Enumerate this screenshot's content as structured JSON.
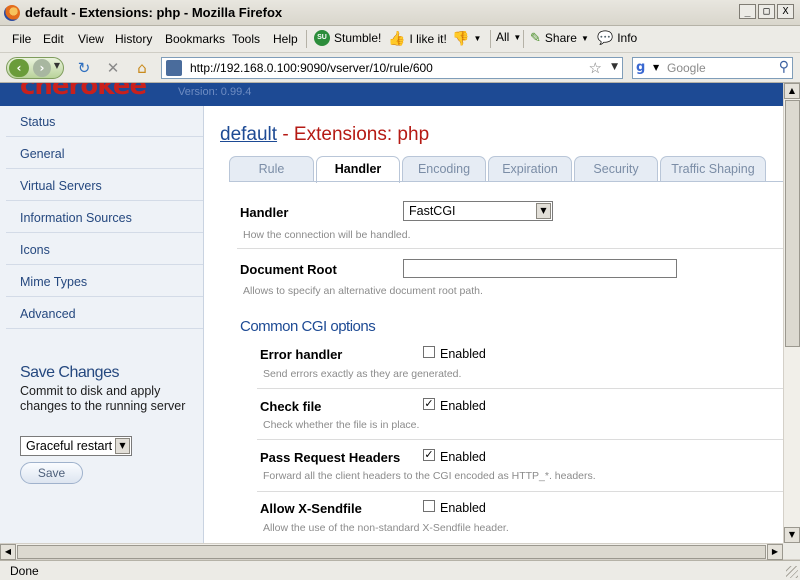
{
  "window": {
    "title": "default - Extensions: php - Mozilla Firefox",
    "controls": [
      "_",
      "□",
      "X"
    ]
  },
  "menubar": {
    "items": [
      "File",
      "Edit",
      "View",
      "History",
      "Bookmarks",
      "Tools",
      "Help"
    ],
    "stumble_label": "Stumble!",
    "ilike_label": "I like it!",
    "all_label": "All",
    "share_label": "Share",
    "info_label": "Info"
  },
  "navbar": {
    "url": "http://192.168.0.100:9090/vserver/10/rule/600",
    "search_placeholder": "Google",
    "search_engine_icon": "g"
  },
  "banner": {
    "logo_text": "cherokee",
    "version": "Version: 0.99.4",
    "color": "#1d4a94",
    "logo_color": "#c9201c"
  },
  "sidebar": {
    "items": [
      "Status",
      "General",
      "Virtual Servers",
      "Information Sources",
      "Icons",
      "Mime Types",
      "Advanced"
    ],
    "save_title": "Save Changes",
    "save_desc": "Commit to disk and apply changes to the running server",
    "restart_value": "Graceful restart",
    "save_button": "Save"
  },
  "content": {
    "heading_link": "default",
    "heading_rest": " - Extensions: php",
    "tabs": [
      "Rule",
      "Handler",
      "Encoding",
      "Expiration",
      "Security",
      "Traffic Shaping"
    ],
    "active_tab": "Handler",
    "handler": {
      "label": "Handler",
      "value": "FastCGI",
      "help": "How the connection will be handled."
    },
    "docroot": {
      "label": "Document Root",
      "value": "",
      "help": "Allows to specify an alternative document root path."
    },
    "cgi_section_title": "Common CGI options",
    "enabled_label": "Enabled",
    "options": [
      {
        "label": "Error handler",
        "checked": false,
        "help": "Send errors exactly as they are generated."
      },
      {
        "label": "Check file",
        "checked": true,
        "help": "Check whether the file is in place."
      },
      {
        "label": "Pass Request Headers",
        "checked": true,
        "help": "Forward all the client headers to the CGI encoded as HTTP_*. headers."
      },
      {
        "label": "Allow X-Sendfile",
        "checked": false,
        "help": "Allow the use of the non-standard X-Sendfile header."
      }
    ],
    "accent_color": "#b51a14",
    "link_color": "#1d4a94"
  },
  "statusbar": {
    "text": "Done"
  }
}
